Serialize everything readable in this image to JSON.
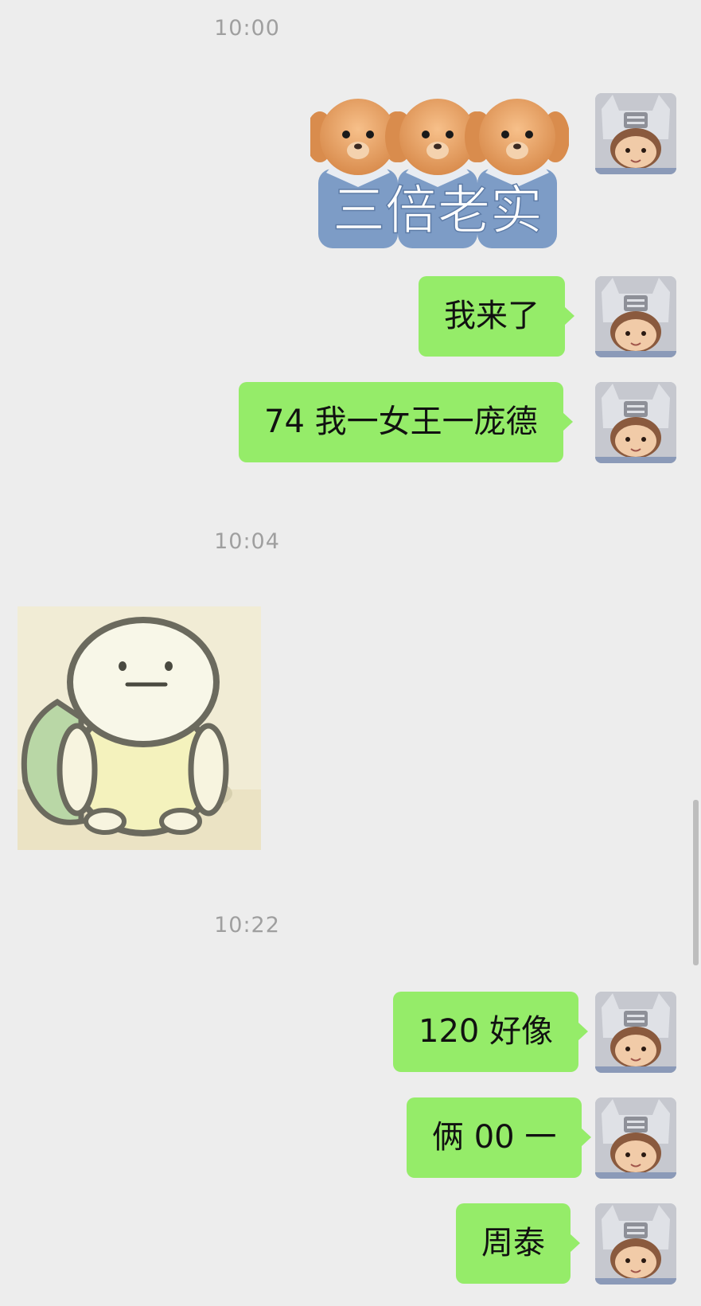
{
  "messages": [
    {
      "type": "timestamp",
      "text": "10:00"
    },
    {
      "type": "sticker",
      "side": "right",
      "caption": "三倍老实"
    },
    {
      "type": "text",
      "side": "right",
      "text": "我来了"
    },
    {
      "type": "text",
      "side": "right",
      "text": "74 我一女王一庞德"
    },
    {
      "type": "timestamp",
      "text": "10:04"
    },
    {
      "type": "sticker",
      "side": "left",
      "description": "turtle-sticker"
    },
    {
      "type": "timestamp",
      "text": "10:22"
    },
    {
      "type": "text",
      "side": "right",
      "text": "120 好像"
    },
    {
      "type": "text",
      "side": "right",
      "text": "俩 00 一"
    },
    {
      "type": "text",
      "side": "right",
      "text": "周泰"
    }
  ],
  "colors": {
    "background": "#ededed",
    "sent_bubble": "#95ec69",
    "timestamp_text": "#9f9f9f"
  },
  "icons": {
    "avatar": "avatar-doll-icon"
  }
}
